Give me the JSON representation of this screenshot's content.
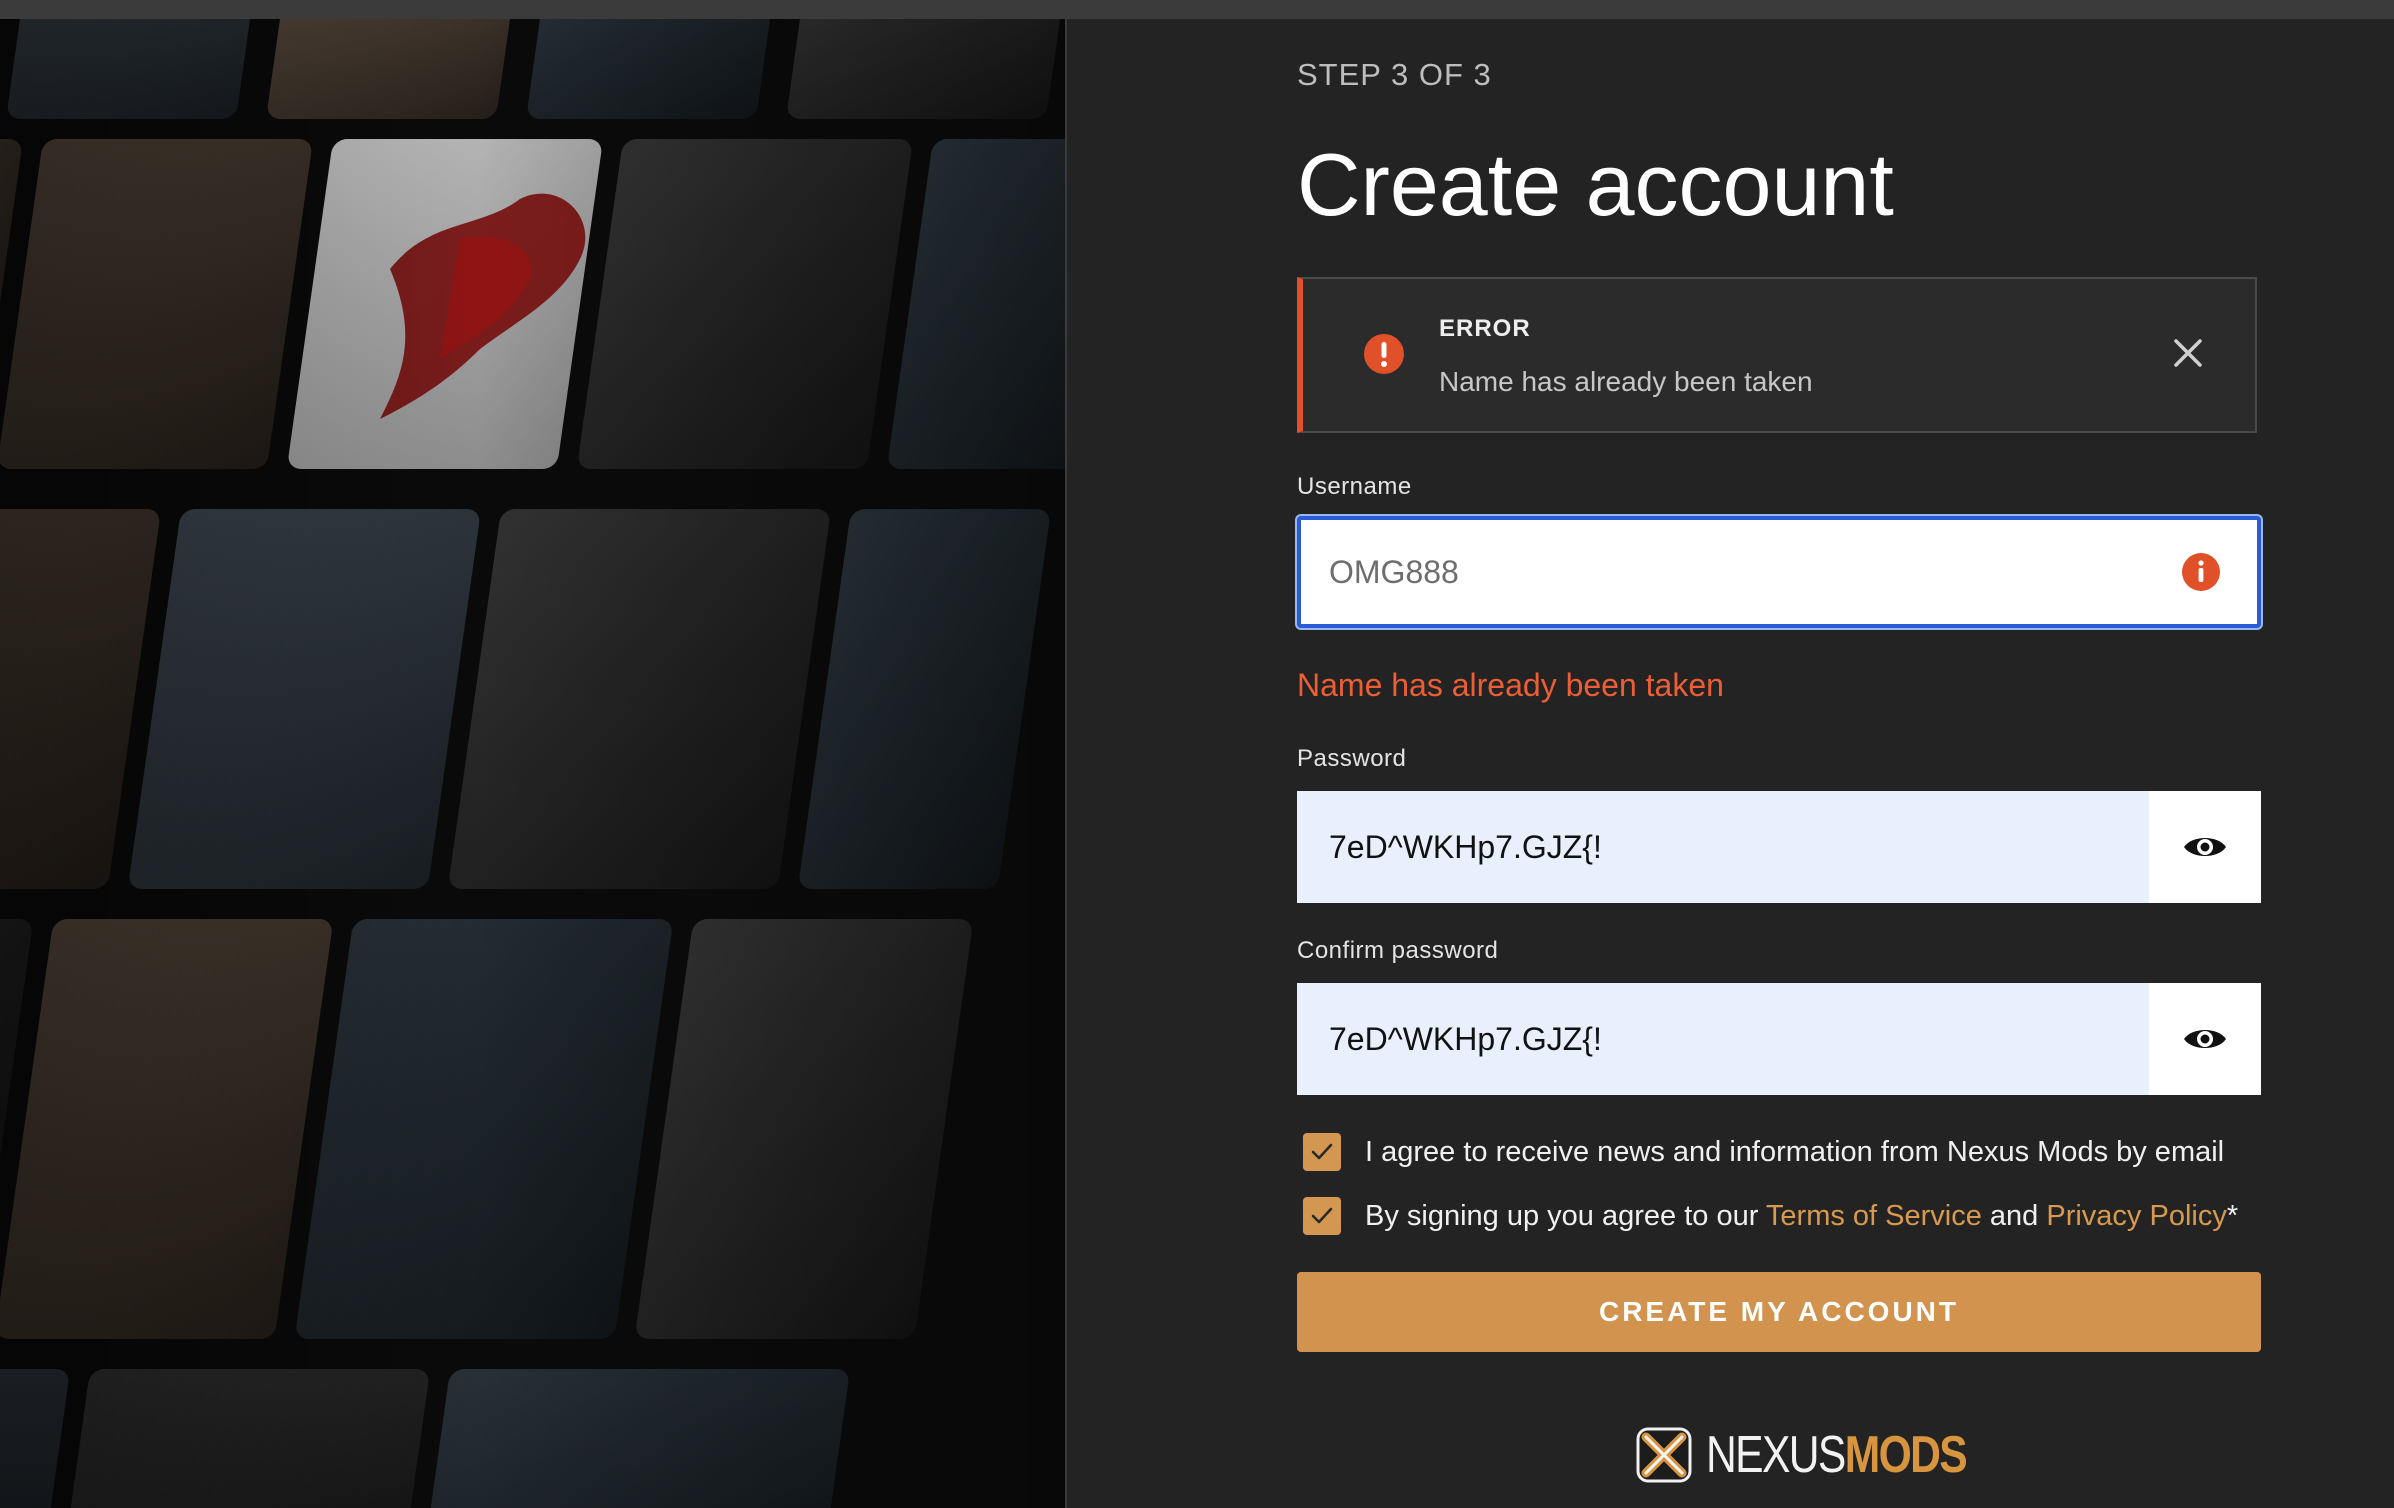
{
  "page": {
    "step": "STEP 3 OF 3",
    "title": "Create account"
  },
  "alert": {
    "title": "ERROR",
    "message": "Name has already been taken",
    "icon": "alert-circle-icon",
    "color": "#e0512a"
  },
  "username": {
    "label": "Username",
    "value": "OMG888",
    "error": "Name has already been taken",
    "icon": "info-icon"
  },
  "password": {
    "label": "Password",
    "value": "7eD^WKHp7.GJZ{!",
    "toggle_icon": "eye-icon"
  },
  "confirm_password": {
    "label": "Confirm password",
    "value": "7eD^WKHp7.GJZ{!",
    "toggle_icon": "eye-icon"
  },
  "consents": {
    "news": "I agree to receive news and information from Nexus Mods by email",
    "terms_prefix": "By signing up you agree to our ",
    "terms_link": "Terms of Service",
    "and": " and ",
    "privacy_link": "Privacy Policy",
    "required_mark": "*"
  },
  "submit": {
    "label": "CREATE MY ACCOUNT",
    "color": "#d2934e"
  },
  "brand": {
    "name_part1": "NEXUS",
    "name_part2": "MODS",
    "accent": "#d8953f"
  }
}
